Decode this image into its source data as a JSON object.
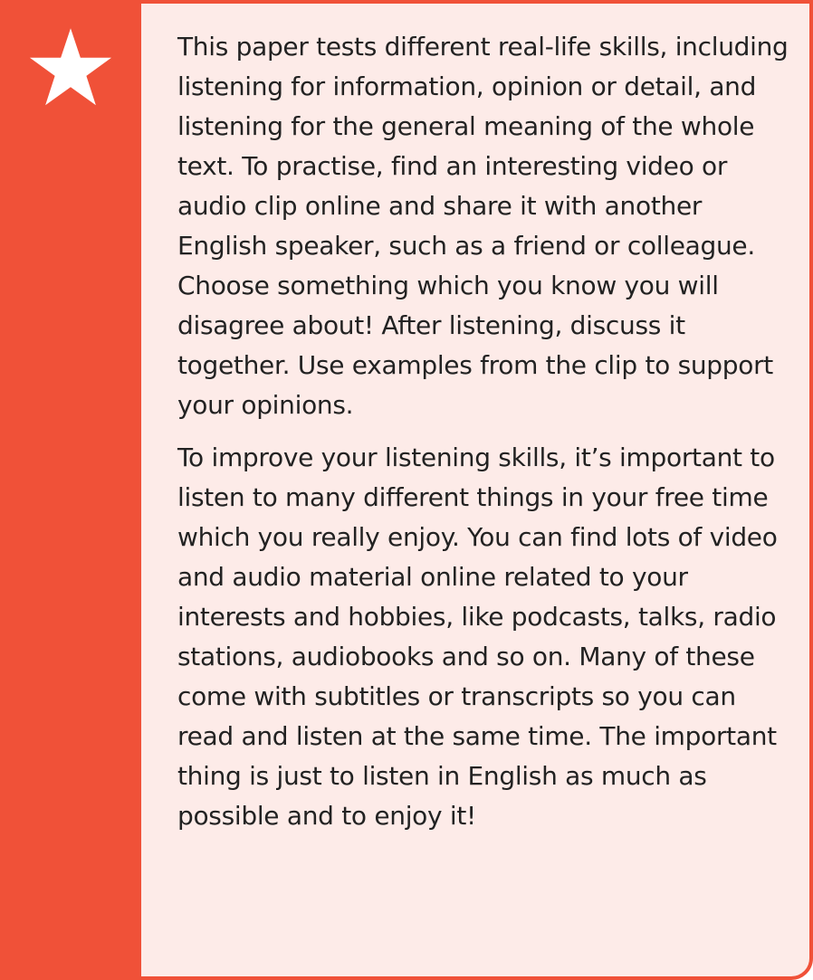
{
  "tip": {
    "icon": "star-icon",
    "paragraphs": [
      "This paper tests different real-life skills, including listening for information, opinion or detail, and listening for the general meaning of the whole text. To practise, find an interesting video or audio clip online and share it with another English speaker, such as a friend or colleague. Choose something which you know you will disagree about! After listening, discuss it together. Use examples from the clip to support your opinions.",
      "To improve your listening skills, it’s important to listen to many different things in your free time which you really enjoy. You can find lots of video and audio material online related to your interests and hobbies, like podcasts, talks, radio stations, audiobooks and so on. Many of these come with subtitles or transcripts so you can read and listen at the same time. The important thing is just to listen in English as much as possible and to enjoy it!"
    ]
  },
  "colors": {
    "accent": "#f05138",
    "background": "#fdebe8",
    "text": "#222222"
  }
}
